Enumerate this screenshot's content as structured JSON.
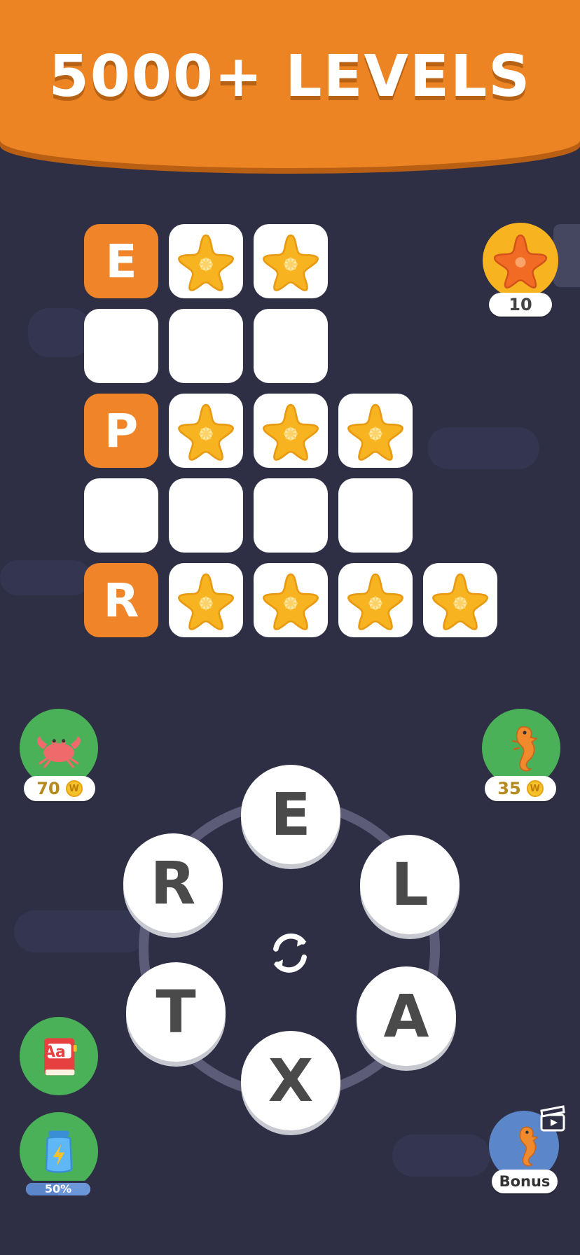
{
  "banner": {
    "title": "5000+  LEVELS"
  },
  "board": {
    "rows": [
      {
        "first_letter": "E",
        "star_tiles": 2,
        "state": "hinted"
      },
      {
        "first_letter": "",
        "empty_tiles": 3,
        "state": "empty"
      },
      {
        "first_letter": "P",
        "star_tiles": 3,
        "state": "hinted"
      },
      {
        "first_letter": "",
        "empty_tiles": 4,
        "state": "empty"
      },
      {
        "first_letter": "R",
        "star_tiles": 4,
        "state": "hinted"
      }
    ]
  },
  "starfish_counter": {
    "value": "10",
    "icon": "starfish-icon"
  },
  "crab_hint": {
    "cost": "70",
    "icon": "crab-icon"
  },
  "seahorse_hint": {
    "cost": "35",
    "icon": "seahorse-icon"
  },
  "dictionary": {
    "label": "Aa",
    "icon": "dictionary-book-icon"
  },
  "energy_jar": {
    "progress": "50%",
    "icon": "lightning-jar-icon"
  },
  "bonus": {
    "label": "Bonus",
    "icon": "seahorse-video-icon"
  },
  "wheel": {
    "letters": [
      "E",
      "L",
      "A",
      "X",
      "T",
      "R"
    ],
    "shuffle_icon": "shuffle-icon"
  },
  "colors": {
    "banner": "#ec8424",
    "background": "#2e2f45",
    "letter_tile": "#ef8428",
    "star": "#f7b320",
    "button_green": "#4bb158",
    "button_blue": "#5b86c9",
    "counter_gold": "#f7b320"
  }
}
